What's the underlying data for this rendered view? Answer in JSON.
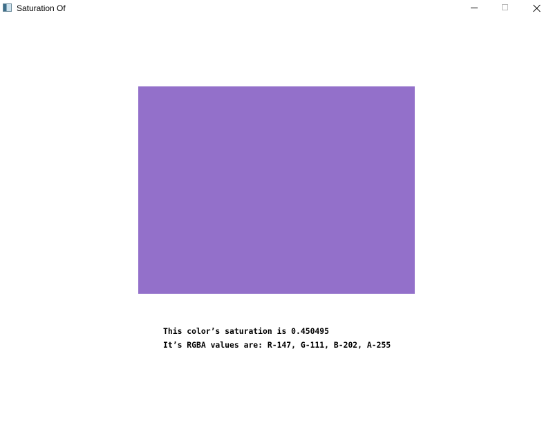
{
  "window": {
    "title": "Saturation Of",
    "icon": "app-window-icon",
    "controls": {
      "minimize_icon": "minimize-icon",
      "maximize_icon": "maximize-icon",
      "close_icon": "close-icon"
    }
  },
  "content": {
    "swatch_color": "#9370CA",
    "saturation_text": "This color’s saturation is 0.450495",
    "rgba_text": "It’s RGBA values are: R-147, G-111, B-202, A-255"
  }
}
